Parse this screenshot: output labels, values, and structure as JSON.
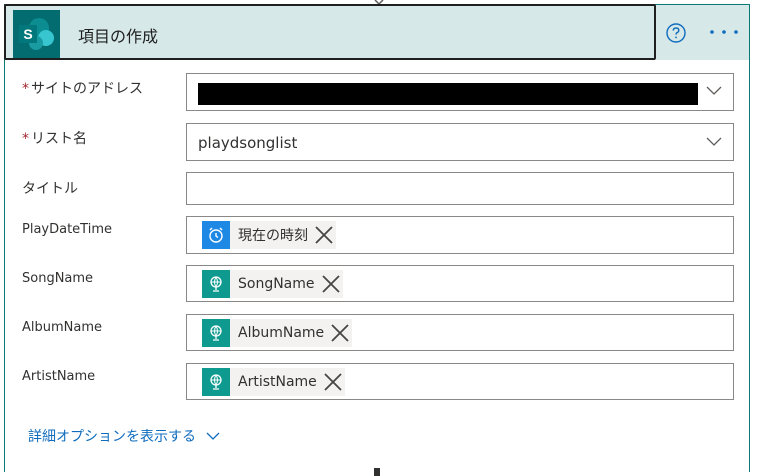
{
  "header": {
    "title": "項目の作成",
    "logo_letter": "S",
    "help_icon": "question-circle-icon",
    "more_icon": "more-ellipsis-icon"
  },
  "fields": {
    "site_address": {
      "label": "サイトのアドレス",
      "required": true
    },
    "list_name": {
      "label": "リスト名",
      "required": true,
      "value": "playdsonglist"
    },
    "title": {
      "label": "タイトル",
      "value": ""
    },
    "play_date_time": {
      "label": "PlayDateTime",
      "token": "現在の時刻"
    },
    "song_name": {
      "label": "SongName",
      "token": "SongName"
    },
    "album_name": {
      "label": "AlbumName",
      "token": "AlbumName"
    },
    "artist_name": {
      "label": "ArtistName",
      "token": "ArtistName"
    }
  },
  "advanced_link": "詳細オプションを表示する",
  "required_mark": "*",
  "colors": {
    "header_bg": "#d6e8e8",
    "logo_bg": "#036c70",
    "link": "#0f6cbd",
    "required": "#a4262c",
    "token_blue": "#1e88e5",
    "token_teal": "#0e9a8f"
  }
}
